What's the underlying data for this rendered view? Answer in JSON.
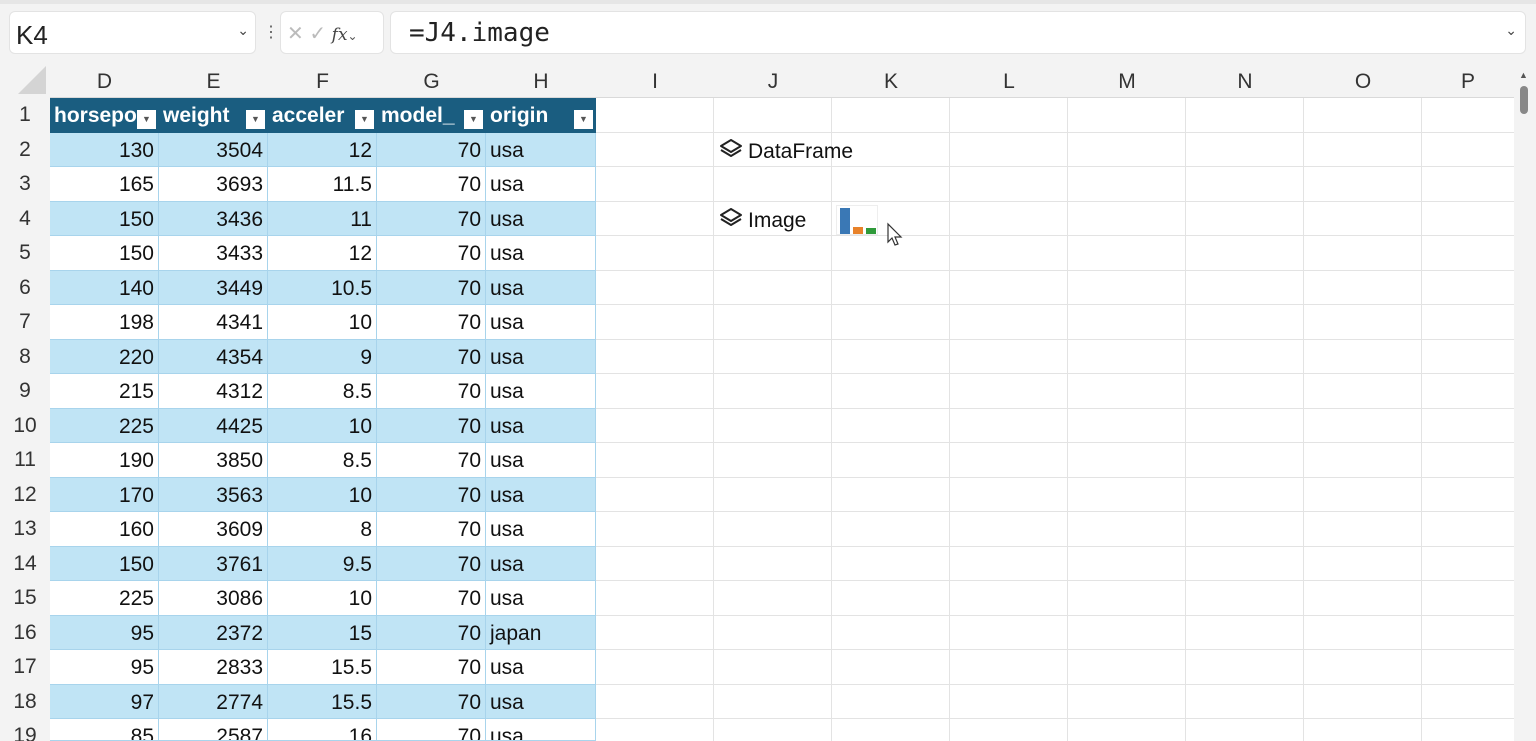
{
  "namebox": {
    "value": "K4"
  },
  "formula_bar": {
    "cancel": "✕",
    "enter": "✓",
    "fx": "fx",
    "value": "=J4.image"
  },
  "columns": [
    "D",
    "E",
    "F",
    "G",
    "H",
    "I",
    "J",
    "K",
    "L",
    "M",
    "N",
    "O",
    "P"
  ],
  "table": {
    "headers": [
      "horsepower",
      "weight",
      "acceleration",
      "model_year",
      "origin"
    ],
    "header_visible": [
      "horsepo",
      "weight",
      "acceler",
      "model_",
      "origin"
    ],
    "rows": [
      [
        "130",
        "3504",
        "12",
        "70",
        "usa"
      ],
      [
        "165",
        "3693",
        "11.5",
        "70",
        "usa"
      ],
      [
        "150",
        "3436",
        "11",
        "70",
        "usa"
      ],
      [
        "150",
        "3433",
        "12",
        "70",
        "usa"
      ],
      [
        "140",
        "3449",
        "10.5",
        "70",
        "usa"
      ],
      [
        "198",
        "4341",
        "10",
        "70",
        "usa"
      ],
      [
        "220",
        "4354",
        "9",
        "70",
        "usa"
      ],
      [
        "215",
        "4312",
        "8.5",
        "70",
        "usa"
      ],
      [
        "225",
        "4425",
        "10",
        "70",
        "usa"
      ],
      [
        "190",
        "3850",
        "8.5",
        "70",
        "usa"
      ],
      [
        "170",
        "3563",
        "10",
        "70",
        "usa"
      ],
      [
        "160",
        "3609",
        "8",
        "70",
        "usa"
      ],
      [
        "150",
        "3761",
        "9.5",
        "70",
        "usa"
      ],
      [
        "225",
        "3086",
        "10",
        "70",
        "usa"
      ],
      [
        "95",
        "2372",
        "15",
        "70",
        "japan"
      ],
      [
        "95",
        "2833",
        "15.5",
        "70",
        "usa"
      ],
      [
        "97",
        "2774",
        "15.5",
        "70",
        "usa"
      ],
      [
        "85",
        "2587",
        "16",
        "70",
        "usa"
      ]
    ]
  },
  "row_numbers": [
    "1",
    "2",
    "3",
    "4",
    "5",
    "6",
    "7",
    "8",
    "9",
    "10",
    "11",
    "12",
    "13",
    "14",
    "15",
    "16",
    "17",
    "18",
    "19"
  ],
  "objects": {
    "j2": "DataFrame",
    "j4": "Image"
  },
  "colors": {
    "header": "#1a5d80",
    "band": "#c0e4f5",
    "bar1": "#3a78b5",
    "bar2": "#e8822a",
    "bar3": "#2f9a3a"
  }
}
